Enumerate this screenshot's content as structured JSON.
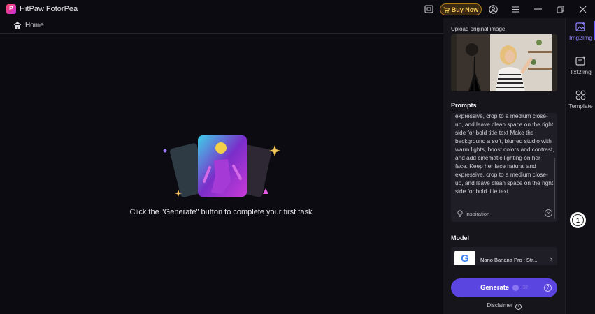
{
  "app": {
    "logo_letter": "P",
    "title": "HitPaw FotorPea"
  },
  "titlebar": {
    "buy_label": "Buy Now"
  },
  "nav": {
    "home_label": "Home"
  },
  "empty_state": {
    "message": "Click the \"Generate\" button to complete your first task"
  },
  "panel": {
    "upload_label": "Upload original image",
    "prompts_title": "Prompts",
    "prompt_text": "expressive, crop to a medium close-up, and leave clean space on the right side for bold title text Make the background a soft, blurred studio with warm lights, boost colors and contrast, and add cinematic lighting on her face. Keep her face natural and expressive, crop to a medium close-up, and leave clean space on the right side for bold title text",
    "inspiration_label": "inspiration",
    "model_title": "Model",
    "model_badge": "G",
    "model_name": "Nano Banana Pro : Str...",
    "generate_label": "Generate",
    "generate_cost": "32",
    "disclaimer_label": "Disclaimer"
  },
  "right_nav": [
    {
      "label": "Img2Img",
      "active": true
    },
    {
      "label": "Txt2Img",
      "active": false
    },
    {
      "label": "Template",
      "active": false
    }
  ],
  "notification": {
    "count": "1"
  },
  "colors": {
    "accent": "#5b45e0",
    "buy_gold": "#f5c75a",
    "active_nav": "#8f82ff"
  }
}
